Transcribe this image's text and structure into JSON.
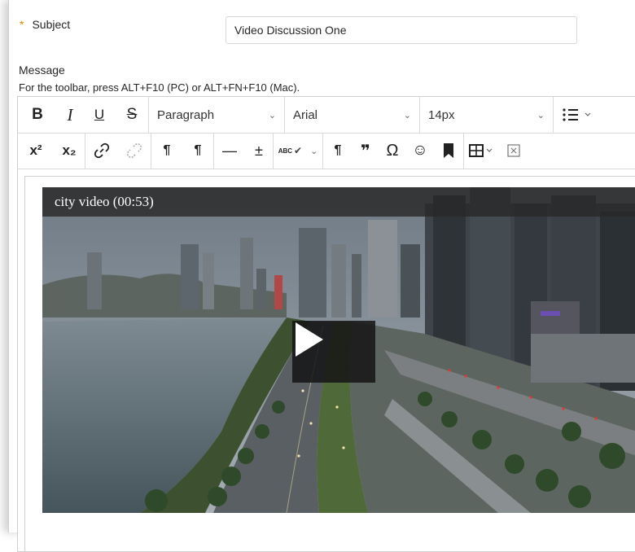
{
  "form": {
    "subject_label": "Subject",
    "required_marker": "*",
    "subject_value": "Video Discussion One",
    "message_label": "Message",
    "toolbar_hint": "For the toolbar, press ALT+F10 (PC) or ALT+FN+F10 (Mac)."
  },
  "toolbar": {
    "bold": "B",
    "italic": "I",
    "underline": "U",
    "strikethrough": "S",
    "paragraph_select": "Paragraph",
    "font_select": "Arial",
    "size_select": "14px",
    "superscript": "x²",
    "subscript": "x₂",
    "ltr": "¶",
    "rtl": "¶",
    "hr": "—",
    "plus_minus": "±",
    "spellcheck": "ABC",
    "show_blocks": "¶",
    "blockquote": "❞",
    "omega": "Ω",
    "emoji": "☺"
  },
  "video": {
    "title": "city video (00:53)"
  }
}
